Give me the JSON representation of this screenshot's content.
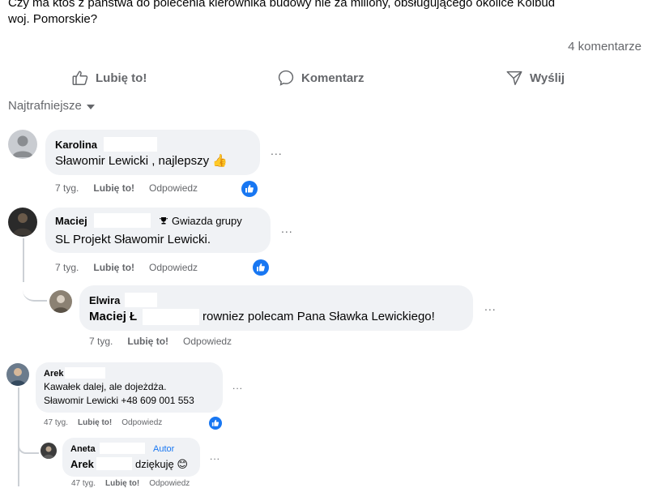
{
  "post": {
    "text_line1": "Czy ma ktoś z państwa do polecenia kierownika budowy nie za miliony, obsługującego okolice Kolbud",
    "text_line2": "woj. Pomorskie?",
    "comment_count": "4 komentarze"
  },
  "actions": {
    "like": "Lubię to!",
    "comment": "Komentarz",
    "send": "Wyślij"
  },
  "sort": {
    "label": "Najtrafniejsze"
  },
  "colors": {
    "accent": "#1877f2",
    "bubble": "#f0f2f5",
    "muted": "#65676b"
  },
  "comments": [
    {
      "author": "Karolina",
      "text": "Sławomir Lewicki , najlepszy",
      "emoji": "👍",
      "time": "7 tyg.",
      "like": "Lubię to!",
      "reply": "Odpowiedz"
    },
    {
      "author": "Maciej",
      "badge": "Gwiazda grupy",
      "text": "SL Projekt Sławomir Lewicki.",
      "time": "7 tyg.",
      "like": "Lubię to!",
      "reply": "Odpowiedz"
    },
    {
      "author": "Elwira",
      "mention": "Maciej Ł",
      "text": "rowniez polecam Pana Sławka Lewickiego!",
      "time": "7 tyg.",
      "like": "Lubię to!",
      "reply": "Odpowiedz"
    },
    {
      "author": "Arek",
      "line1": "Kawałek dalej, ale dojeżdża.",
      "line2": "Sławomir Lewicki +48 609 001 553",
      "time": "47 tyg.",
      "like": "Lubię to!",
      "reply": "Odpowiedz"
    },
    {
      "author": "Aneta",
      "badge": "Autor",
      "mention": "Arek",
      "text": "dziękuję",
      "emoji": "😊",
      "time": "47 tyg.",
      "like": "Lubię to!",
      "reply": "Odpowiedz"
    }
  ],
  "ellipsis": "..."
}
